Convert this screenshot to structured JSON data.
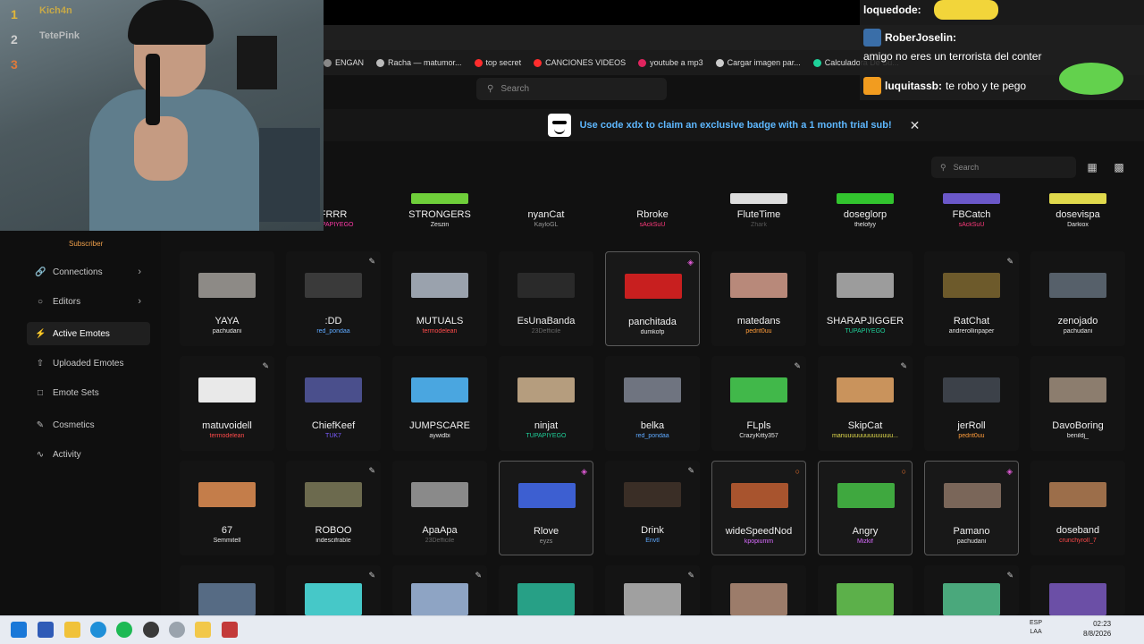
{
  "bookmarks": [
    {
      "label": "ENGAN",
      "color": "#888888"
    },
    {
      "label": "Racha — matumor...",
      "color": "#bbbbbb"
    },
    {
      "label": "top secret",
      "color": "#ff2d2d"
    },
    {
      "label": "CANCIONES VIDEOS",
      "color": "#ff2d2d"
    },
    {
      "label": "youtube a mp3",
      "color": "#e0245e"
    },
    {
      "label": "Cargar imagen par...",
      "color": "#cccccc"
    },
    {
      "label": "Calculadora De Su...",
      "color": "#1fd19a"
    }
  ],
  "top_search": {
    "placeholder": "Search"
  },
  "banner": {
    "text": "Use code xdx to claim an exclusive badge with a 1 month trial sub!"
  },
  "emote_search": {
    "placeholder": "Search"
  },
  "sidebar": {
    "badge": "Subscriber",
    "items": [
      {
        "label": "Connections",
        "icon": "link-icon",
        "active": false,
        "chevron": true
      },
      {
        "label": "Editors",
        "icon": "user-circle-icon",
        "active": false,
        "chevron": true
      },
      {
        "label": "Active Emotes",
        "icon": "lightning-icon",
        "active": true,
        "chevron": false
      },
      {
        "label": "Uploaded Emotes",
        "icon": "upload-icon",
        "active": false,
        "chevron": false
      },
      {
        "label": "Emote Sets",
        "icon": "folder-icon",
        "active": false,
        "chevron": false
      },
      {
        "label": "Cosmetics",
        "icon": "brush-icon",
        "active": false,
        "chevron": false
      },
      {
        "label": "Activity",
        "icon": "activity-icon",
        "active": false,
        "chevron": false
      }
    ]
  },
  "emote_rows": [
    [
      {
        "name": "FRRR",
        "owner": "TUPAPIYEGO",
        "owner_color": "#ff3aa8"
      },
      {
        "name": "STRONGERS",
        "owner": "Zeszin",
        "owner_color": "#e6e6e6",
        "thumb": "#6fcf3a"
      },
      {
        "name": "nyanCat",
        "owner": "KayloGL",
        "owner_color": "#999999"
      },
      {
        "name": "Rbroke",
        "owner": "sAckSuU",
        "owner_color": "#ff3a7c"
      },
      {
        "name": "FluteTime",
        "owner": "Zhark",
        "owner_color": "#555555",
        "thumb": "#dddddd"
      },
      {
        "name": "doseglorp",
        "owner": "thelofyy",
        "owner_color": "#e6e6e6",
        "thumb": "#32c42e"
      },
      {
        "name": "FBCatch",
        "owner": "sAckSuU",
        "owner_color": "#ff3a7c",
        "thumb": "#6b58c9"
      },
      {
        "name": "dosevispa",
        "owner": "Darkiox",
        "owner_color": "#e6e6e6",
        "thumb": "#e0d94c"
      }
    ],
    [
      {
        "name": "YAYA",
        "owner": "pachudani",
        "owner_color": "#e6e6e6",
        "thumb": "#8d8a86"
      },
      {
        "name": ":DD",
        "owner": "red_pondaa",
        "owner_color": "#5ea9ff",
        "thumb": "#3a3a3a",
        "badge": "pencil-icon"
      },
      {
        "name": "MUTUALS",
        "owner": "termodelean",
        "owner_color": "#ff4a4a",
        "thumb": "#9aa2ad"
      },
      {
        "name": "EsUnaBanda",
        "owner": "23Defficile",
        "owner_color": "#666666",
        "thumb": "#2a2a2a"
      },
      {
        "name": "panchitada",
        "owner": "dumkofp",
        "owner_color": "#e6e6e6",
        "thumb": "#c81f1f",
        "badge": "layers-icon",
        "highlight": true
      },
      {
        "name": "matedans",
        "owner": "pedrit0uu",
        "owner_color": "#ff9c3a",
        "thumb": "#b8897a"
      },
      {
        "name": "SHARAPJIGGER",
        "owner": "TUPAPIYEGO",
        "owner_color": "#1fd19a",
        "thumb": "#9c9c9c"
      },
      {
        "name": "RatChat",
        "owner": "andrerollinpaper",
        "owner_color": "#e6e6e6",
        "thumb": "#6d5a2b",
        "badge": "pencil-icon"
      },
      {
        "name": "zenojado",
        "owner": "pachudani",
        "owner_color": "#e6e6e6",
        "thumb": "#56606a"
      }
    ],
    [
      {
        "name": "matuvoidell",
        "owner": "termodelean",
        "owner_color": "#ff4a4a",
        "thumb": "#e9e9e9",
        "badge": "pencil-icon"
      },
      {
        "name": "ChiefKeef",
        "owner": "TUK7",
        "owner_color": "#7a5cff",
        "thumb": "#4a4f8c"
      },
      {
        "name": "JUMPSCARE",
        "owner": "aywidbi",
        "owner_color": "#e6e6e6",
        "thumb": "#4aa6e0"
      },
      {
        "name": "ninjat",
        "owner": "TUPAPIYEGO",
        "owner_color": "#1fd19a",
        "thumb": "#b59d7e"
      },
      {
        "name": "belka",
        "owner": "red_pondaa",
        "owner_color": "#5ea9ff",
        "thumb": "#6f7480"
      },
      {
        "name": "FLpls",
        "owner": "CrazyKitty357",
        "owner_color": "#e6e6e6",
        "thumb": "#41b84a",
        "badge": "pencil-icon"
      },
      {
        "name": "SkipCat",
        "owner": "manuuuuuuuuuuuuuu...",
        "owner_color": "#e0d94c",
        "thumb": "#c9935c",
        "badge": "pencil-icon"
      },
      {
        "name": "jerRoll",
        "owner": "pedrit0uu",
        "owner_color": "#ff9c3a",
        "thumb": "#3c4149"
      },
      {
        "name": "DavoBoring",
        "owner": "benildj_",
        "owner_color": "#e6e6e6",
        "thumb": "#8c7d6e"
      }
    ],
    [
      {
        "name": "67",
        "owner": "Semmitell",
        "owner_color": "#e6e6e6",
        "thumb": "#c47d4a"
      },
      {
        "name": "ROBOO",
        "owner": "indescifrable",
        "owner_color": "#e6e6e6",
        "thumb": "#6c6a4e",
        "badge": "pencil-icon"
      },
      {
        "name": "ApaApa",
        "owner": "23Defficile",
        "owner_color": "#666666",
        "thumb": "#8a8a8a"
      },
      {
        "name": "Rlove",
        "owner": "eyzs",
        "owner_color": "#999999",
        "thumb": "#3d5fd1",
        "badge": "layers-icon",
        "highlight": true
      },
      {
        "name": "Drink",
        "owner": "Envtl",
        "owner_color": "#5ea9ff",
        "thumb": "#3a2e26",
        "badge": "pencil-icon"
      },
      {
        "name": "wideSpeedNod",
        "owner": "kpopiumm",
        "owner_color": "#d96cff",
        "thumb": "#a8542e",
        "badge": "flame-icon",
        "highlight": true
      },
      {
        "name": "Angry",
        "owner": "Mizkif",
        "owner_color": "#d96cff",
        "thumb": "#3fa83f",
        "badge": "flame-icon",
        "highlight": true
      },
      {
        "name": "Pamano",
        "owner": "pachudani",
        "owner_color": "#e6e6e6",
        "thumb": "#7a6659",
        "badge": "layers-icon",
        "highlight": true
      },
      {
        "name": "doseband",
        "owner": "crunchyroll_7",
        "owner_color": "#ff4a4a",
        "thumb": "#9c6e4a"
      }
    ],
    [
      {
        "name": "",
        "owner": "",
        "thumb": "#566b84"
      },
      {
        "name": "",
        "owner": "",
        "thumb": "#46c8c8",
        "badge": "pencil-icon"
      },
      {
        "name": "",
        "owner": "",
        "thumb": "#8ea4c4",
        "badge": "pencil-icon"
      },
      {
        "name": "",
        "owner": "",
        "thumb": "#27a086"
      },
      {
        "name": "",
        "owner": "",
        "thumb": "#a0a0a0",
        "badge": "pencil-icon"
      },
      {
        "name": "",
        "owner": "",
        "thumb": "#9c7c6a"
      },
      {
        "name": "",
        "owner": "",
        "thumb": "#5cb04a"
      },
      {
        "name": "",
        "owner": "",
        "thumb": "#4aa87c",
        "badge": "pencil-icon"
      },
      {
        "name": "",
        "owner": "",
        "thumb": "#6b4fa6"
      }
    ]
  ],
  "leaderboard": [
    {
      "rank": "1",
      "name": "Kich4n",
      "color": "#e0b63a"
    },
    {
      "rank": "2",
      "name": "TetePink",
      "color": "#cfcfcf"
    },
    {
      "rank": "3",
      "name": "",
      "color": "#e07a3a"
    }
  ],
  "chat": [
    {
      "user": "loquedode:",
      "text": "",
      "user_color": "#ffffff"
    },
    {
      "user": "RoberJoselin:",
      "text": "amigo no eres un terrorista del conter",
      "user_color": "#ffffff"
    },
    {
      "user": "luquitassb:",
      "text": "te robo y te pego",
      "user_color": "#ffffff"
    }
  ],
  "taskbar": {
    "lang_top": "ESP",
    "lang_bottom": "LAA",
    "time": "02:23",
    "date": "8/8/2026"
  }
}
